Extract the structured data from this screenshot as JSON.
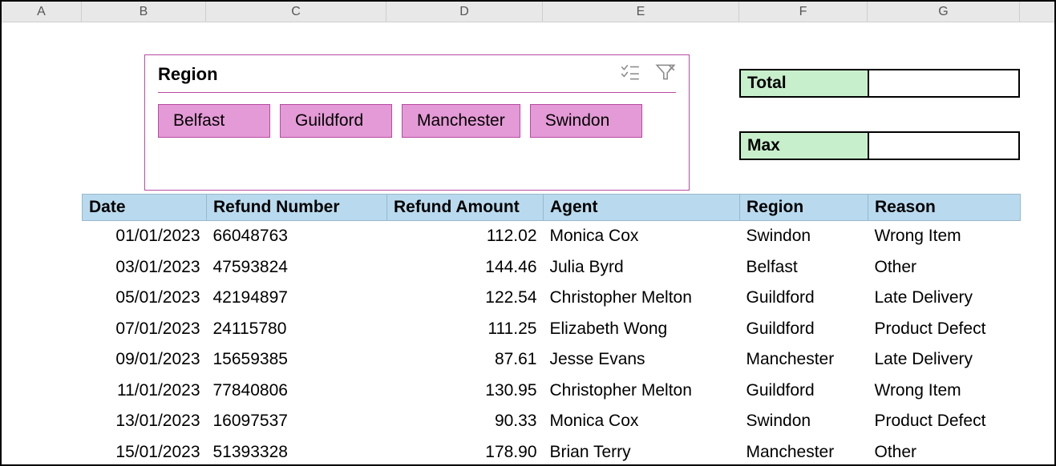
{
  "columns": {
    "A": "A",
    "B": "B",
    "C": "C",
    "D": "D",
    "E": "E",
    "F": "F",
    "G": "G"
  },
  "slicer": {
    "title": "Region",
    "items": [
      "Belfast",
      "Guildford",
      "Manchester",
      "Swindon"
    ]
  },
  "summary": {
    "total_label": "Total",
    "total_value": "",
    "max_label": "Max",
    "max_value": ""
  },
  "table": {
    "headers": {
      "date": "Date",
      "refnum": "Refund Number",
      "amount": "Refund Amount",
      "agent": "Agent",
      "region": "Region",
      "reason": "Reason"
    },
    "rows": [
      {
        "date": "01/01/2023",
        "refnum": "66048763",
        "amount": "112.02",
        "agent": "Monica Cox",
        "region": "Swindon",
        "reason": "Wrong Item"
      },
      {
        "date": "03/01/2023",
        "refnum": "47593824",
        "amount": "144.46",
        "agent": "Julia Byrd",
        "region": "Belfast",
        "reason": "Other"
      },
      {
        "date": "05/01/2023",
        "refnum": "42194897",
        "amount": "122.54",
        "agent": "Christopher Melton",
        "region": "Guildford",
        "reason": "Late Delivery"
      },
      {
        "date": "07/01/2023",
        "refnum": "24115780",
        "amount": "111.25",
        "agent": "Elizabeth Wong",
        "region": "Guildford",
        "reason": "Product Defect"
      },
      {
        "date": "09/01/2023",
        "refnum": "15659385",
        "amount": "87.61",
        "agent": "Jesse Evans",
        "region": "Manchester",
        "reason": "Late Delivery"
      },
      {
        "date": "11/01/2023",
        "refnum": "77840806",
        "amount": "130.95",
        "agent": "Christopher Melton",
        "region": "Guildford",
        "reason": "Wrong Item"
      },
      {
        "date": "13/01/2023",
        "refnum": "16097537",
        "amount": "90.33",
        "agent": "Monica Cox",
        "region": "Swindon",
        "reason": "Product Defect"
      },
      {
        "date": "15/01/2023",
        "refnum": "51393328",
        "amount": "178.90",
        "agent": "Brian Terry",
        "region": "Manchester",
        "reason": "Other"
      }
    ]
  }
}
